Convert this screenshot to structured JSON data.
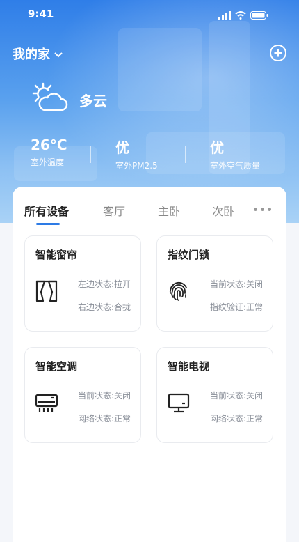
{
  "status_bar": {
    "time": "9:41"
  },
  "header": {
    "home_name": "我的家"
  },
  "weather": {
    "condition": "多云"
  },
  "stats": [
    {
      "value": "26°C",
      "label": "室外温度"
    },
    {
      "value": "优",
      "label": "室外PM2.5"
    },
    {
      "value": "优",
      "label": "室外空气质量"
    }
  ],
  "tabs": [
    {
      "label": "所有设备",
      "active": true
    },
    {
      "label": "客厅"
    },
    {
      "label": "主卧"
    },
    {
      "label": "次卧"
    }
  ],
  "devices": [
    {
      "name": "智能窗帘",
      "icon": "curtain-icon",
      "line1": "左边状态:拉开",
      "line2": "右边状态:合拢"
    },
    {
      "name": "指纹门锁",
      "icon": "fingerprint-icon",
      "line1": "当前状态:关闭",
      "line2": "指纹验证:正常"
    },
    {
      "name": "智能空调",
      "icon": "air-conditioner-icon",
      "line1": "当前状态:关闭",
      "line2": "网络状态:正常"
    },
    {
      "name": "智能电视",
      "icon": "tv-icon",
      "line1": "当前状态:关闭",
      "line2": "网络状态:正常"
    }
  ],
  "colors": {
    "accent": "#2d7be5",
    "hero_top": "#2f7ee8",
    "hero_bottom": "#a9d2f6"
  }
}
